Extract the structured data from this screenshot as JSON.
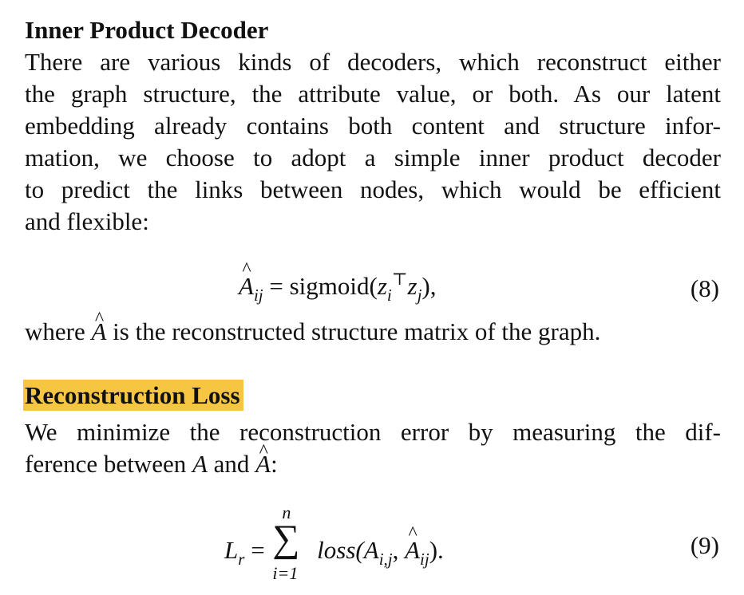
{
  "section1": {
    "heading": "Inner Product Decoder",
    "lines": [
      "There are various kinds of decoders, which reconstruct either",
      "the graph structure, the attribute value, or both.  As our latent",
      "embedding already contains both content and structure infor-",
      "mation, we choose to adopt a simple inner product decoder",
      "to predict the links between nodes, which would be efficient",
      "and flexible:"
    ],
    "equation": {
      "lhs_var": "A",
      "lhs_sub": "ij",
      "equals": "=",
      "func": "sigmoid(",
      "z1": "z",
      "z1_sub": "i",
      "transpose": "⊤",
      "z2": "z",
      "z2_sub": "j",
      "close": "),",
      "number": "(8)"
    },
    "after_pre": "where ",
    "after_var": "A",
    "after_post": " is the reconstructed structure matrix of the graph."
  },
  "section2": {
    "heading": "Reconstruction Loss",
    "line1": "We minimize the reconstruction error by measuring the dif-",
    "line2_pre": "ference between ",
    "line2_var1": "A",
    "line2_mid": " and ",
    "line2_var2": "A",
    "line2_post": ":",
    "equation": {
      "lhs_var": "L",
      "lhs_sub": "r",
      "equals": "=",
      "sum_top": "n",
      "sum_symbol": "∑",
      "sum_bottom": "i=1",
      "func": "loss(",
      "a1": "A",
      "a1_sub": "i,j",
      "comma": ", ",
      "a2": "A",
      "a2_sub": "ij",
      "close": ").",
      "number": "(9)"
    }
  },
  "colors": {
    "highlight": "#f6c643",
    "text": "#111111",
    "background": "#ffffff"
  }
}
